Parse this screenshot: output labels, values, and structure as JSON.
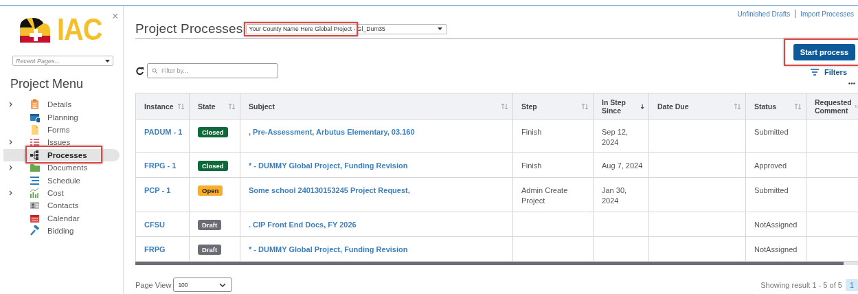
{
  "sidebar": {
    "logo_text": "IAC",
    "close": "×",
    "recent_pages": {
      "placeholder": "Recent Pages..."
    },
    "menu_title": "Project Menu",
    "items": [
      {
        "label": "Details",
        "expandable": true,
        "selected": false,
        "highlighted": false
      },
      {
        "label": "Planning",
        "expandable": false,
        "selected": false,
        "highlighted": false
      },
      {
        "label": "Forms",
        "expandable": false,
        "selected": false,
        "highlighted": false
      },
      {
        "label": "Issues",
        "expandable": true,
        "selected": false,
        "highlighted": false
      },
      {
        "label": "Processes",
        "expandable": false,
        "selected": true,
        "highlighted": true
      },
      {
        "label": "Documents",
        "expandable": true,
        "selected": false,
        "highlighted": false
      },
      {
        "label": "Schedule",
        "expandable": false,
        "selected": false,
        "highlighted": false
      },
      {
        "label": "Cost",
        "expandable": true,
        "selected": false,
        "highlighted": false
      },
      {
        "label": "Contacts",
        "expandable": false,
        "selected": false,
        "highlighted": false
      },
      {
        "label": "Calendar",
        "expandable": false,
        "selected": false,
        "highlighted": false
      },
      {
        "label": "Bidding",
        "expandable": false,
        "selected": false,
        "highlighted": false
      }
    ]
  },
  "header": {
    "links": [
      "Unfinished Drafts",
      "Import Processes"
    ],
    "title": "Project Processes",
    "project_select": {
      "value": "Your County Name Here Global Project - Gl_Dum35",
      "highlighted": true
    }
  },
  "toolbar": {
    "filter": {
      "placeholder": "Filter by..."
    },
    "start_button": {
      "label": "Start process",
      "highlighted": true
    },
    "filters_label": "Filters"
  },
  "table": {
    "columns": [
      {
        "label": "Instance",
        "sorted": false
      },
      {
        "label": "State",
        "sorted": false
      },
      {
        "label": "Subject",
        "sorted": false
      },
      {
        "label": "Step",
        "sorted": false
      },
      {
        "label": "In Step Since",
        "sorted": true
      },
      {
        "label": "Date Due",
        "sorted": false
      },
      {
        "label": "Status",
        "sorted": false
      },
      {
        "label": "Requested Comment",
        "sorted": false
      }
    ],
    "rows": [
      {
        "instance": "PADUM - 1",
        "state": {
          "label": "Closed",
          "color": "#0f6a3b"
        },
        "subject": ", Pre-Assessment, Arbutus Elementary, 03.160",
        "step": "Finish",
        "in_step_since": "Sep 12, 2024",
        "status": "Submitted"
      },
      {
        "instance": "FRPG - 1",
        "state": {
          "label": "Closed",
          "color": "#0f6a3b"
        },
        "subject": "* - DUMMY Global Project, Funding Revision",
        "step": "Finish",
        "in_step_since": "Aug 7, 2024",
        "status": "Approved"
      },
      {
        "instance": "PCP - 1",
        "state": {
          "label": "Open",
          "color": "#f8ae2b"
        },
        "subject": "Some school 240130153245 Project Request,",
        "step": "Admin Create Project",
        "in_step_since": "Jan 30, 2024",
        "status": "Submitted"
      },
      {
        "instance": "CFSU",
        "state": {
          "label": "Draft",
          "color": "#6b6d74"
        },
        "subject": ". CIP Front End Docs, FY 2026",
        "status": "NotAssigned"
      },
      {
        "instance": "FRPG",
        "state": {
          "label": "Draft",
          "color": "#6b6d74"
        },
        "subject": "* - DUMMY Global Project, Funding Revision",
        "status": "NotAssigned"
      }
    ]
  },
  "footer": {
    "page_view_label": "Page View",
    "page_size": "100",
    "summary": "Showing result 1 - 5 of 5",
    "pages": [
      {
        "label": "1",
        "selected": true
      }
    ]
  }
}
